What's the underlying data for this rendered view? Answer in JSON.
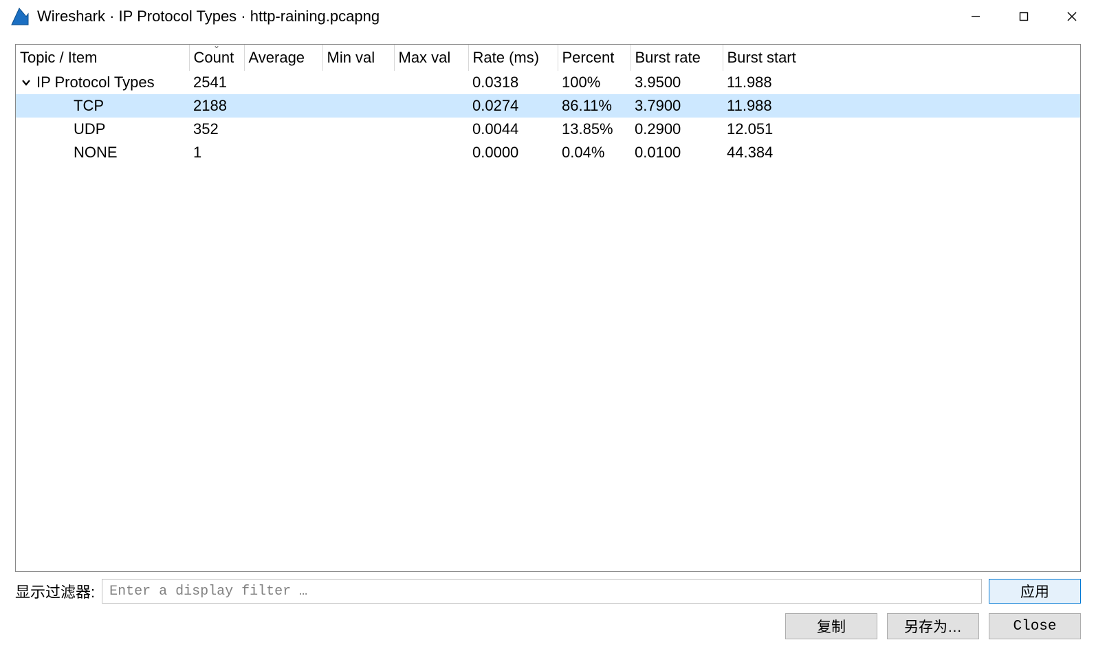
{
  "window": {
    "title": "Wireshark · IP Protocol Types · http-raining.pcapng"
  },
  "table": {
    "columns": [
      "Topic / Item",
      "Count",
      "Average",
      "Min val",
      "Max val",
      "Rate (ms)",
      "Percent",
      "Burst rate",
      "Burst start"
    ],
    "root": {
      "topic": "IP Protocol Types",
      "count": "2541",
      "rate": "0.0318",
      "percent": "100%",
      "burst_rate": "3.9500",
      "burst_start": "11.988"
    },
    "children": [
      {
        "topic": "TCP",
        "count": "2188",
        "rate": "0.0274",
        "percent": "86.11%",
        "burst_rate": "3.7900",
        "burst_start": "11.988",
        "selected": true
      },
      {
        "topic": "UDP",
        "count": "352",
        "rate": "0.0044",
        "percent": "13.85%",
        "burst_rate": "0.2900",
        "burst_start": "12.051",
        "selected": false
      },
      {
        "topic": "NONE",
        "count": "1",
        "rate": "0.0000",
        "percent": "0.04%",
        "burst_rate": "0.0100",
        "burst_start": "44.384",
        "selected": false
      }
    ]
  },
  "filter": {
    "label": "显示过滤器:",
    "placeholder": "Enter a display filter …",
    "value": "",
    "apply": "应用"
  },
  "buttons": {
    "copy": "复制",
    "save_as": "另存为…",
    "close": "Close"
  }
}
